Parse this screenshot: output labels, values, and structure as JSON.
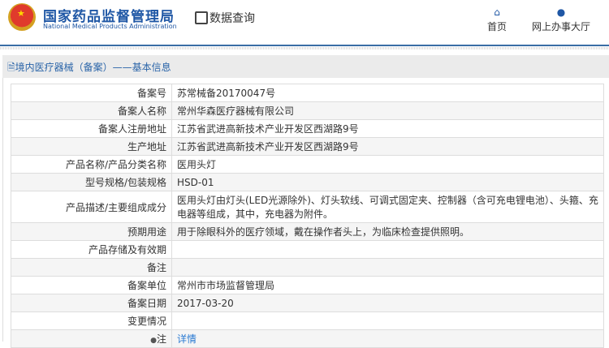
{
  "header": {
    "title_cn": "国家药品监督管理局",
    "title_en": "National Medical Products Administration",
    "data_query": "数据查询",
    "nav": [
      {
        "label": "首页",
        "icon": "home-icon"
      },
      {
        "label": "网上办事大厅",
        "icon": "user-icon"
      }
    ]
  },
  "section_title": "境内医疗器械（备案）——基本信息",
  "rows": [
    {
      "label": "备案号",
      "value": "苏常械备20170047号"
    },
    {
      "label": "备案人名称",
      "value": "常州华森医疗器械有限公司"
    },
    {
      "label": "备案人注册地址",
      "value": "江苏省武进高新技术产业开发区西湖路9号"
    },
    {
      "label": "生产地址",
      "value": "江苏省武进高新技术产业开发区西湖路9号"
    },
    {
      "label": "产品名称/产品分类名称",
      "value": "医用头灯"
    },
    {
      "label": "型号规格/包装规格",
      "value": "HSD-01"
    },
    {
      "label": "产品描述/主要组成成分",
      "value": "医用头灯由灯头(LED光源除外)、灯头软线、可调式固定夹、控制器（含可充电锂电池）、头箍、充电器等组成，其中，充电器为附件。"
    },
    {
      "label": "预期用途",
      "value": "用于除眼科外的医疗领域，戴在操作者头上，为临床检查提供照明。"
    },
    {
      "label": "产品存储及有效期",
      "value": ""
    },
    {
      "label": "备注",
      "value": ""
    },
    {
      "label": "备案单位",
      "value": "常州市市场监督管理局"
    },
    {
      "label": "备案日期",
      "value": "2017-03-20"
    },
    {
      "label": "变更情况",
      "value": ""
    },
    {
      "label": "注",
      "value": "详情"
    }
  ]
}
